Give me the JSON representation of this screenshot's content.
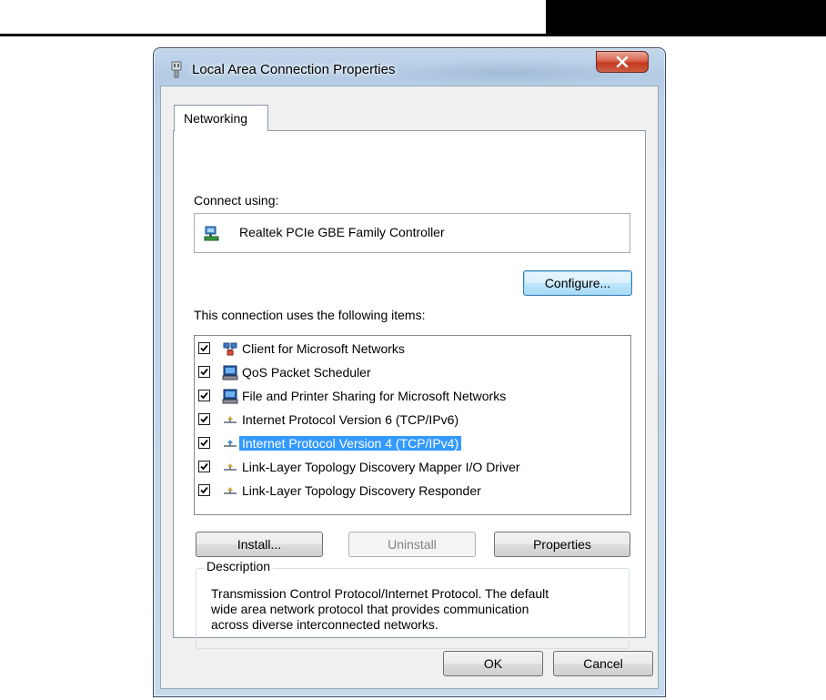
{
  "window": {
    "title": "Local Area Connection Properties",
    "close_symbol": "X"
  },
  "tabs": [
    {
      "label": "Networking",
      "active": true
    }
  ],
  "connect_using": {
    "label": "Connect using:",
    "adapter_name": "Realtek PCIe GBE Family Controller",
    "adapter_icon": "network-adapter-icon"
  },
  "configure_button": "Configure...",
  "items_label": "This connection uses the following items:",
  "items": [
    {
      "label": "Client for Microsoft Networks",
      "checked": true,
      "icon": "network-client-icon",
      "selected": false
    },
    {
      "label": "QoS Packet Scheduler",
      "checked": true,
      "icon": "computer-service-icon",
      "selected": false
    },
    {
      "label": "File and Printer Sharing for Microsoft Networks",
      "checked": true,
      "icon": "computer-service-icon",
      "selected": false
    },
    {
      "label": "Internet Protocol Version 6 (TCP/IPv6)",
      "checked": true,
      "icon": "protocol-icon",
      "selected": false
    },
    {
      "label": "Internet Protocol Version 4 (TCP/IPv4)",
      "checked": true,
      "icon": "protocol-icon",
      "selected": true
    },
    {
      "label": "Link-Layer Topology Discovery Mapper I/O Driver",
      "checked": true,
      "icon": "protocol-icon",
      "selected": false
    },
    {
      "label": "Link-Layer Topology Discovery Responder",
      "checked": true,
      "icon": "protocol-icon",
      "selected": false
    }
  ],
  "buttons": {
    "install": "Install...",
    "uninstall": "Uninstall",
    "properties": "Properties",
    "ok": "OK",
    "cancel": "Cancel"
  },
  "description": {
    "label": "Description",
    "lines": [
      "Transmission Control Protocol/Internet Protocol. The default",
      "wide area network protocol that provides communication",
      "across diverse interconnected networks."
    ]
  },
  "colors": {
    "selection": "#3399ff",
    "close_button": "#c4391f"
  }
}
